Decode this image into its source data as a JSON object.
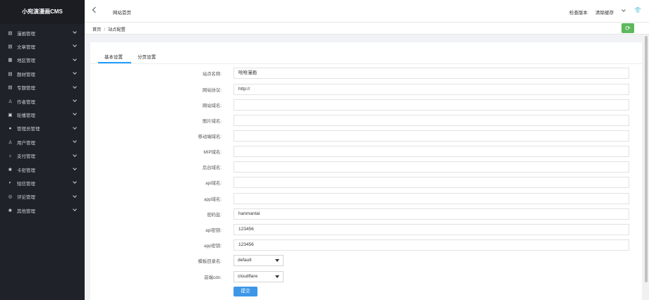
{
  "app": {
    "logo": "小宛演漫画CMS"
  },
  "sidebar": {
    "items": [
      {
        "label": "漫画管理",
        "icon": "book-icon"
      },
      {
        "label": "文章管理",
        "icon": "file-icon"
      },
      {
        "label": "地区管理",
        "icon": "location-icon"
      },
      {
        "label": "题材管理",
        "icon": "tag-icon"
      },
      {
        "label": "专题管理",
        "icon": "folder-icon"
      },
      {
        "label": "作者管理",
        "icon": "user-icon"
      },
      {
        "label": "轮播管理",
        "icon": "carousel-icon"
      },
      {
        "label": "管理员管理",
        "icon": "admin-icon"
      },
      {
        "label": "用户管理",
        "icon": "users-icon"
      },
      {
        "label": "支付管理",
        "icon": "cart-icon"
      },
      {
        "label": "卡密管理",
        "icon": "key-icon"
      },
      {
        "label": "短信管理",
        "icon": "message-icon"
      },
      {
        "label": "评论管理",
        "icon": "comment-icon"
      },
      {
        "label": "其他管理",
        "icon": "settings-icon"
      }
    ]
  },
  "topbar": {
    "home_label": "网站首页",
    "check_label": "检查版本",
    "clear_label": "清除缓存"
  },
  "breadcrumb": {
    "home": "首页",
    "separator": "/",
    "current": "站点配置"
  },
  "tabs": {
    "basic": "基本设置",
    "paging": "分页设置"
  },
  "form": {
    "fields": [
      {
        "label": "站点名称:",
        "value": "哈哈漫画"
      },
      {
        "label": "网站协议:",
        "value": "http://"
      },
      {
        "label": "网站域名:",
        "value": ""
      },
      {
        "label": "图片域名:",
        "value": ""
      },
      {
        "label": "移动端域名:",
        "value": ""
      },
      {
        "label": "MIP域名:",
        "value": ""
      },
      {
        "label": "后台域名:",
        "value": ""
      },
      {
        "label": "api域名:",
        "value": ""
      },
      {
        "label": "app域名:",
        "value": ""
      },
      {
        "label": "密码盐:",
        "value": "hanmantai"
      },
      {
        "label": "api密钥:",
        "value": "123456"
      },
      {
        "label": "app密钥:",
        "value": "123456"
      }
    ],
    "template_label": "模板目录名:",
    "template_value": "default",
    "cdn_label": "前端cdn:",
    "cdn_value": "cloudflare",
    "submit_label": "提交"
  },
  "colors": {
    "sidebar_bg": "#20222a",
    "accent": "#1e9fff",
    "submit": "#3d97e6",
    "refresh": "#5cb85c"
  }
}
